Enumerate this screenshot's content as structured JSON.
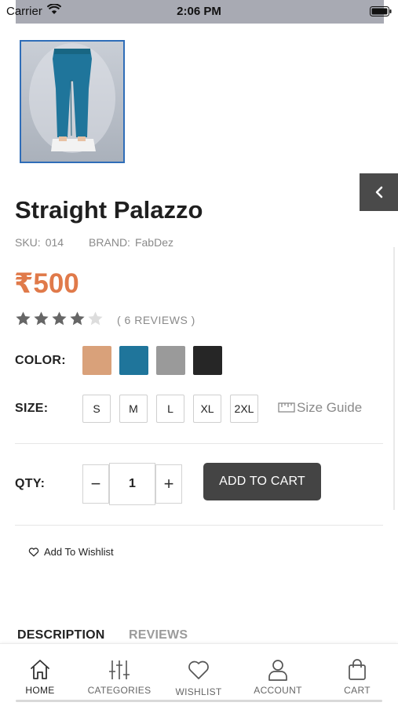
{
  "status_bar": {
    "carrier": "Carrier",
    "time": "2:06 PM"
  },
  "product": {
    "title": "Straight Palazzo",
    "sku_label": "SKU:",
    "sku_value": "014",
    "brand_label": "BRAND:",
    "brand_value": "FabDez",
    "price": "₹500",
    "rating": 4,
    "rating_max": 5,
    "reviews_text": "( 6 REVIEWS )"
  },
  "color": {
    "label": "COLOR:",
    "swatches": [
      {
        "name": "tan",
        "hex": "#d9a17a"
      },
      {
        "name": "teal",
        "hex": "#1f759b"
      },
      {
        "name": "gray",
        "hex": "#9a9a9a"
      },
      {
        "name": "black",
        "hex": "#262626"
      }
    ]
  },
  "size": {
    "label": "SIZE:",
    "options": [
      "S",
      "M",
      "L",
      "XL",
      "2XL"
    ],
    "guide_label": "Size Guide"
  },
  "qty": {
    "label": "QTY:",
    "value": "1",
    "minus": "−",
    "plus": "+"
  },
  "actions": {
    "add_to_cart": "ADD TO CART",
    "add_to_wishlist": "Add To Wishlist"
  },
  "tabs": {
    "description": "DESCRIPTION",
    "reviews": "REVIEWS"
  },
  "bottom_nav": {
    "home": "HOME",
    "categories": "CATEGORIES",
    "wishlist": "WISHLIST",
    "account": "ACCOUNT",
    "cart": "CART"
  },
  "colors": {
    "price": "#e07a4a",
    "star_filled": "#666666",
    "star_empty": "#dddddd",
    "button_dark": "#444444",
    "thumb_border": "#2f6db8",
    "product_teal": "#1f759b"
  }
}
